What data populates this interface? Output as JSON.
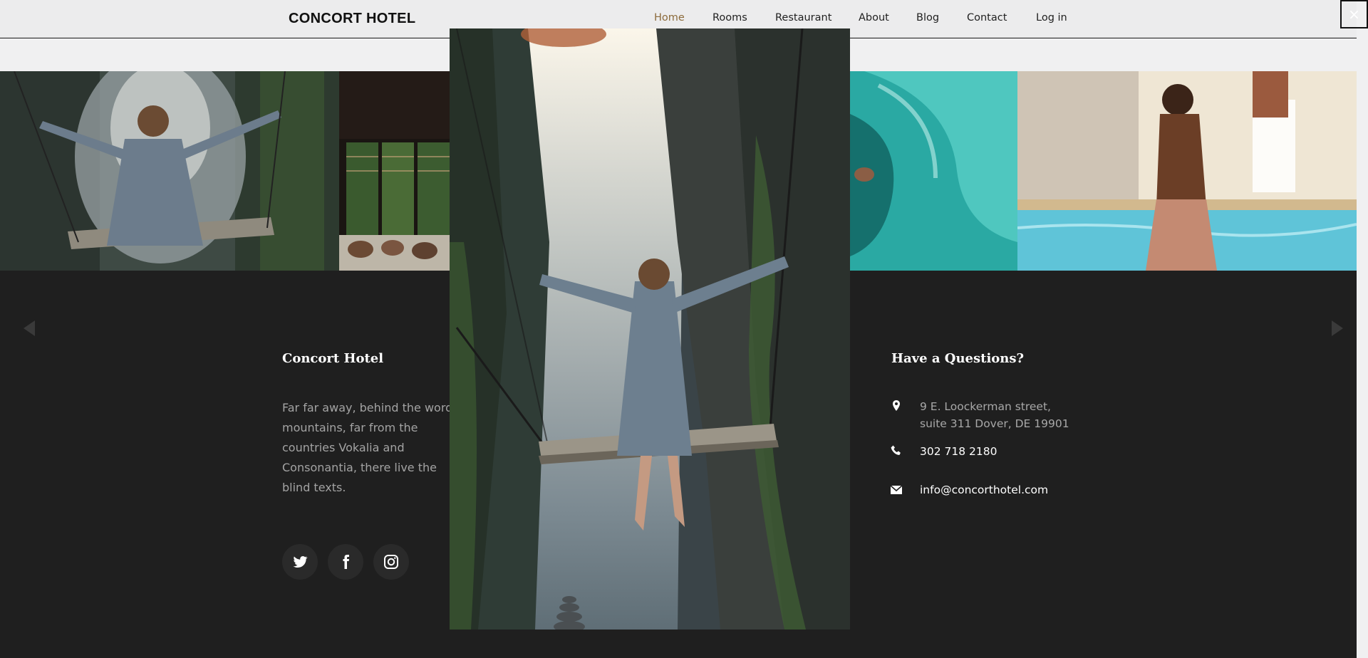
{
  "brand": "CONCORT HOTEL",
  "nav": {
    "items": [
      {
        "label": "Home",
        "active": true
      },
      {
        "label": "Rooms",
        "active": false
      },
      {
        "label": "Restaurant",
        "active": false
      },
      {
        "label": "About",
        "active": false
      },
      {
        "label": "Blog",
        "active": false
      },
      {
        "label": "Contact",
        "active": false
      },
      {
        "label": "Log in",
        "active": false
      }
    ]
  },
  "gallery": {
    "tiles": [
      {
        "subject": "woman on swing at waterfall"
      },
      {
        "subject": "restaurant interior with sofa"
      },
      {
        "subject": "surfer in turquoise wave"
      },
      {
        "subject": "woman by swimming pool"
      }
    ]
  },
  "footer": {
    "about": {
      "heading": "Concort Hotel",
      "text": "Far far away, behind the word mountains, far from the countries Vokalia and Consonantia, there live the blind texts."
    },
    "social": [
      {
        "icon": "twitter-icon"
      },
      {
        "icon": "facebook-icon"
      },
      {
        "icon": "instagram-icon"
      }
    ],
    "contact": {
      "heading": "Have a Questions?",
      "address_line1": "9 E. Loockerman street,",
      "address_line2": "suite 311 Dover, DE 19901",
      "phone": "302 718 2180",
      "email": "info@concorthotel.com"
    }
  },
  "lightbox": {
    "close_label": "×",
    "subject": "woman on swing above waterfall canyon"
  },
  "colors": {
    "nav_bg": "#ececed",
    "nav_active": "#8c6b3c",
    "footer_bg": "#1f1f1f",
    "footer_text": "#a3a3a3",
    "heading_text": "#ffffff"
  }
}
